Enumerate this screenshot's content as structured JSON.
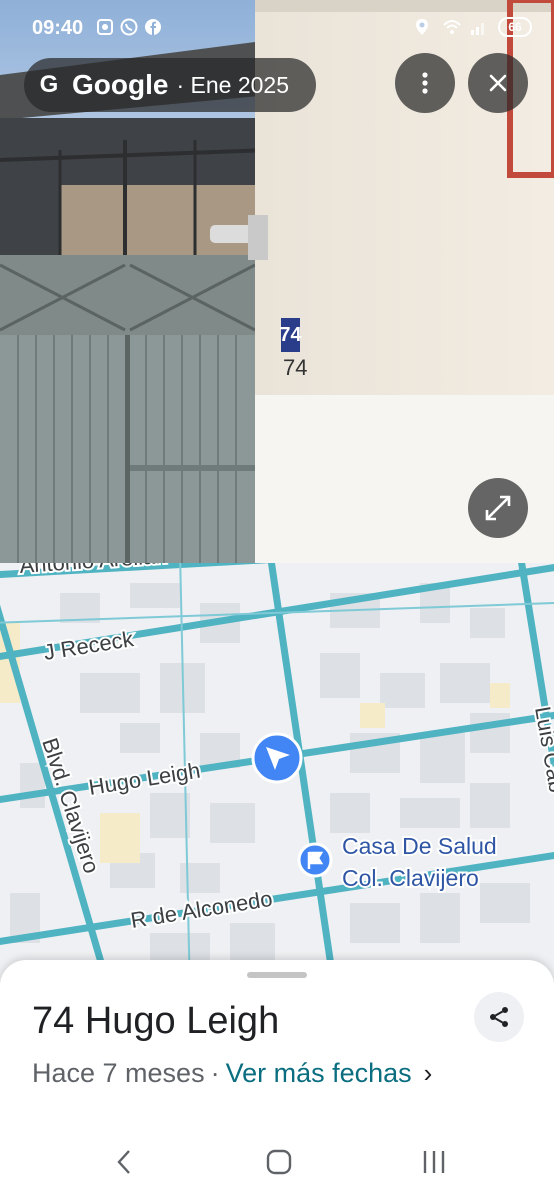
{
  "status_bar": {
    "time": "09:40",
    "battery": "66"
  },
  "header": {
    "g_letter": "G",
    "brand": "Google",
    "separator": "·",
    "date": "Ene 2025"
  },
  "photo": {
    "plate_number": "74",
    "plate_number_small": "74"
  },
  "map": {
    "streets": [
      "Antonio Arellan",
      "J Receck",
      "Hugo Leigh",
      "Blvd. Clavijero",
      "R de Alconedo",
      "Luis Cab"
    ],
    "poi": {
      "name_line1": "Casa De Salud",
      "name_line2": "Col. Clavijero"
    }
  },
  "sheet": {
    "title": "74 Hugo Leigh",
    "age": "Hace 7 meses",
    "separator": "·",
    "more_dates": "Ver más fechas",
    "chevron": "›"
  },
  "colors": {
    "road": "#4fb3c2",
    "accent": "#0b6e80",
    "marker": "#4285f4"
  }
}
